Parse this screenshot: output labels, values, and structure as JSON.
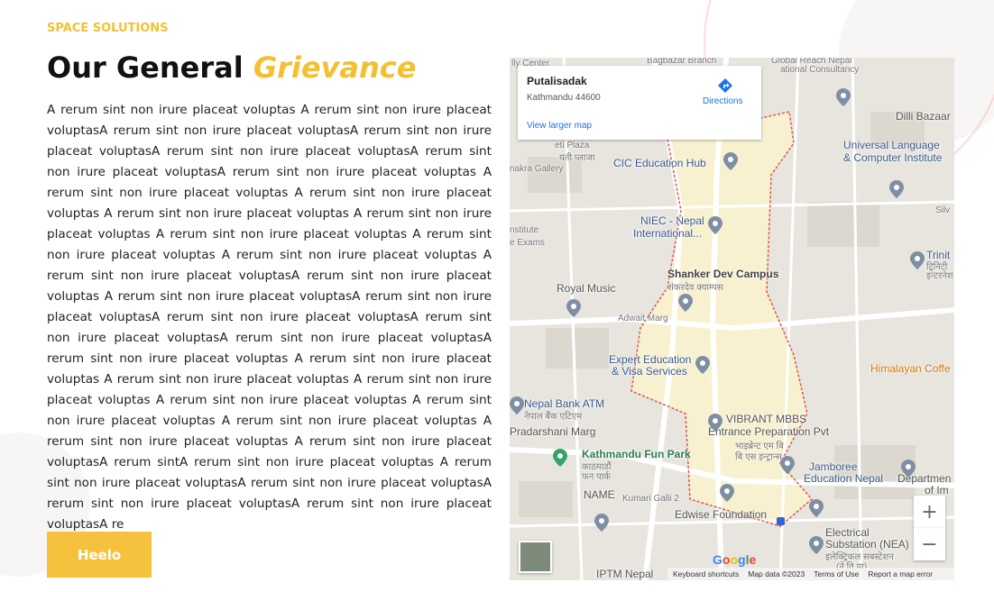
{
  "section": {
    "eyebrow": "SPACE SOLUTIONS",
    "title_plain": "Our General",
    "title_accent": "Grievance",
    "body": "A rerum sint non irure placeat voluptas A rerum sint non irure placeat voluptasA rerum sint non irure placeat voluptasA rerum sint non irure placeat voluptasA rerum sint non irure placeat voluptasA rerum sint non irure placeat voluptasA rerum sint non irure placeat voluptas A rerum sint non irure placeat voluptas A rerum sint non irure placeat voluptas A rerum sint non irure placeat voluptas A rerum sint non irure placeat voluptas A rerum sint non irure placeat voluptas A rerum sint non irure placeat voluptas A rerum sint non irure placeat voluptas A rerum sint non irure placeat voluptasA rerum sint non irure placeat voluptas A rerum sint non irure placeat voluptasA rerum sint non irure placeat voluptasA rerum sint non irure placeat voluptasA rerum sint non irure placeat voluptasA rerum sint non irure placeat voluptasA rerum sint non irure placeat voluptas A rerum sint non irure placeat voluptas A rerum sint non irure placeat voluptas A rerum sint non irure placeat voluptas A rerum sint non irure placeat voluptas A rerum sint non irure placeat voluptas A rerum sint non irure placeat voluptas A rerum sint non irure placeat voluptas A rerum sint non irure placeat voluptasA rerum sintA rerum sint non irure placeat voluptas A rerum sint non irure placeat voluptasA rerum sint non irure placeat voluptasA rerum sint non irure placeat voluptasA rerum sint non irure placeat voluptasA re",
    "button_label": "Heelo"
  },
  "map": {
    "info": {
      "place": "Putalisadak",
      "address": "Kathmandu 44600",
      "directions": "Directions",
      "view_larger": "View larger map"
    },
    "labels": {
      "city_center": "lly Center",
      "bagbazar": "Bagbazar Branch",
      "global_reach": "Global Reach Nepal",
      "national_consultancy": "ational Consultancy",
      "dilli_bazaar": "Dilli Bazaar",
      "universal_language": "Universal Language",
      "computer_institute": "& Computer Institute",
      "eti_plaza": "eti Plaza",
      "yeti_plaza_np": "यती प्लाजा",
      "nakra_gallery": "nakra Gallery",
      "cic": "CIC Education Hub",
      "silv": "Silv",
      "niec_1": "NIEC - Nepal",
      "niec_2": "International...",
      "institute": "nstitute",
      "exams": "e Exams",
      "trinit": "Trinit",
      "trinit_np1": "ट्रिनिटी",
      "trinit_np2": "इन्टरनेश",
      "shanker_1": "Shanker Dev Campus",
      "shanker_2": "शंकरदेव क्याम्पस",
      "royal_music": "Royal Music",
      "adwait_marg": "Adwait Marg",
      "expert_1": "Expert Education",
      "expert_2": "& Visa Services",
      "himalayan": "Himalayan Coffe",
      "nepal_bank": "Nepal Bank ATM",
      "nepal_bank_np": "नेपाल बैंक एटिएम",
      "pradarshani": "Pradarshani Marg",
      "vibrant_1": "VIBRANT MBBS",
      "vibrant_2": "Entrance Preparation Pvt",
      "vibrant_3": "भाइब्रेन्ट एम बि",
      "vibrant_4": "बि एस इन्ट्रान्स",
      "fun_park": "Kathmandu Fun Park",
      "fun_park_np1": "काठमाडौं",
      "fun_park_np2": "फन पार्क",
      "jamboree": "Jamboree",
      "edu_nepal": "Education Nepal",
      "department": "Departmen",
      "of_im": "of Im",
      "name": "NAME",
      "kumari_galli": "Kumari Galli 2",
      "edwise": "Edwise Foundation",
      "electrical_1": "Electrical",
      "electrical_2": "Substation (NEA)",
      "electrical_np1": "इलेक्ट्रिकल सबस्टेशन",
      "electrical_np2": "(ने वि प्रा)",
      "iptm": "IPTM Nepal"
    },
    "zoom_in": "+",
    "zoom_out": "−",
    "google": "Google",
    "footer": {
      "shortcuts": "Keyboard shortcuts",
      "map_data": "Map data ©2023",
      "terms": "Terms of Use",
      "report": "Report a map error"
    }
  },
  "colors": {
    "accent": "#f3c032",
    "button": "#f6c23e",
    "link": "#1a73e8"
  }
}
